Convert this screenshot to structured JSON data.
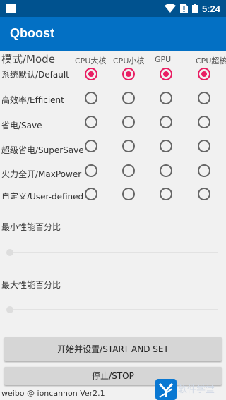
{
  "status_bar": {
    "time": "5:24",
    "icons": [
      "notification-square-icon",
      "wifi-icon",
      "no-sim-icon",
      "battery-icon"
    ]
  },
  "app_bar": {
    "title": "Qboost"
  },
  "mode_table": {
    "mode_header": "模式/Mode",
    "columns": [
      "CPU大核",
      "CPU小核",
      "GPU",
      "CPU超核"
    ],
    "rows": [
      {
        "label": "系统默认/Default",
        "checked": [
          true,
          true,
          true,
          true
        ]
      },
      {
        "label": "高效率/Efficient",
        "checked": [
          false,
          false,
          false,
          false
        ]
      },
      {
        "label": "省电/Save",
        "checked": [
          false,
          false,
          false,
          false
        ]
      },
      {
        "label": "超级省电/SuperSave",
        "checked": [
          false,
          false,
          false,
          false
        ]
      },
      {
        "label": "火力全开/MaxPower",
        "checked": [
          false,
          false,
          false,
          false
        ]
      },
      {
        "label": "自定义/User-defined",
        "checked": [
          false,
          false,
          false,
          false
        ]
      }
    ]
  },
  "min_perf": {
    "label": "最小性能百分比",
    "value": 0
  },
  "max_perf": {
    "label": "最大性能百分比",
    "value": 0
  },
  "buttons": {
    "start": "开始并设置/START AND SET",
    "stop": "停止/STOP"
  },
  "footer": "weibo @ ioncannon Ver2.1",
  "watermark": {
    "text": "软件学堂"
  },
  "colors": {
    "status_bar": "#00528f",
    "app_bar": "#0370c4",
    "radio_checked": "#e91e63",
    "background": "#f1f1f1"
  }
}
